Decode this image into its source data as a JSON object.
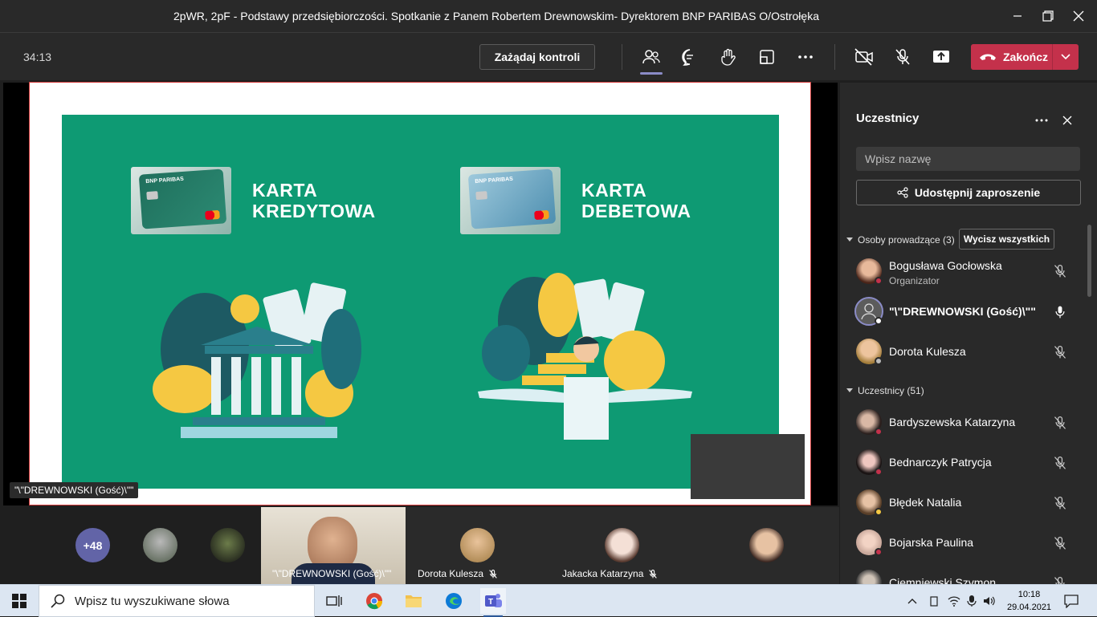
{
  "window": {
    "title": "2pWR, 2pF - Podstawy przedsiębiorczości. Spotkanie z Panem Robertem Drewnowskim- Dyrektorem BNP PARIBAS O/Ostrołęka"
  },
  "toolbar": {
    "timer": "34:13",
    "request_control": "Zażądaj kontroli",
    "end_call": "Zakończ"
  },
  "slide": {
    "left_label": "KARTA\nKREDYTOWA",
    "right_label": "KARTA\nDEBETOWA",
    "card_brand": "BNP PARIBAS",
    "presenter_tag": "\"\\\"DREWNOWSKI (Gość)\\\"\""
  },
  "gallery": {
    "overflow_count": "+48",
    "tiles": [
      {
        "name": "\"\\\"DREWNOWSKI (Gość)\\\"\""
      },
      {
        "name": "Dorota Kulesza"
      },
      {
        "name": "Jakacka Katarzyna"
      }
    ]
  },
  "panel": {
    "title": "Uczestnicy",
    "search_placeholder": "Wpisz nazwę",
    "share_invite": "Udostępnij zaproszenie",
    "presenters_section": "Osoby prowadzące (3)",
    "mute_all": "Wycisz wszystkich",
    "attendees_section": "Uczestnicy (51)",
    "presenters": [
      {
        "name": "Bogusława Gocłowska",
        "role": "Organizator"
      },
      {
        "name": "\"\\\"DREWNOWSKI (Gość)\\\"\""
      },
      {
        "name": "Dorota Kulesza"
      }
    ],
    "attendees": [
      {
        "name": "Bardyszewska Katarzyna"
      },
      {
        "name": "Bednarczyk Patrycja"
      },
      {
        "name": "Błędek Natalia"
      },
      {
        "name": "Bojarska Paulina"
      },
      {
        "name": "Ciemniewski Szymon"
      }
    ]
  },
  "taskbar": {
    "search_placeholder": "Wpisz tu wyszukiwane słowa",
    "time": "10:18",
    "date": "29.04.2021"
  },
  "colors": {
    "accent_red": "#c4314b",
    "slide_green": "#0e9a73",
    "panel_bg": "#292929"
  }
}
